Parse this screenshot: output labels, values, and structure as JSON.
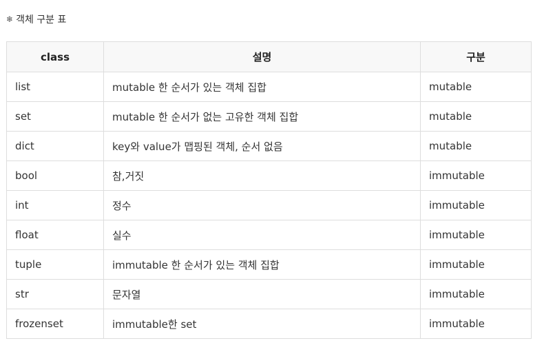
{
  "heading": {
    "icon": "snowflake-mark-icon",
    "mark": "❄",
    "title": "객체 구분 표"
  },
  "table": {
    "headers": [
      "class",
      "설명",
      "구분"
    ],
    "rows": [
      {
        "class": "list",
        "desc": "mutable 한 순서가 있는 객체 집합",
        "kind": "mutable"
      },
      {
        "class": "set",
        "desc": "mutable 한 순서가 없는 고유한 객체 집합",
        "kind": "mutable"
      },
      {
        "class": "dict",
        "desc": "key와 value가 맵핑된 객체, 순서 없음",
        "kind": "mutable"
      },
      {
        "class": "bool",
        "desc": "참,거짓",
        "kind": "immutable"
      },
      {
        "class": "int",
        "desc": "정수",
        "kind": "immutable"
      },
      {
        "class": "float",
        "desc": "실수",
        "kind": "immutable"
      },
      {
        "class": "tuple",
        "desc": "immutable 한 순서가 있는 객체 집합",
        "kind": "immutable"
      },
      {
        "class": "str",
        "desc": "문자열",
        "kind": "immutable"
      },
      {
        "class": "frozenset",
        "desc": "immutable한 set",
        "kind": "immutable"
      }
    ]
  }
}
